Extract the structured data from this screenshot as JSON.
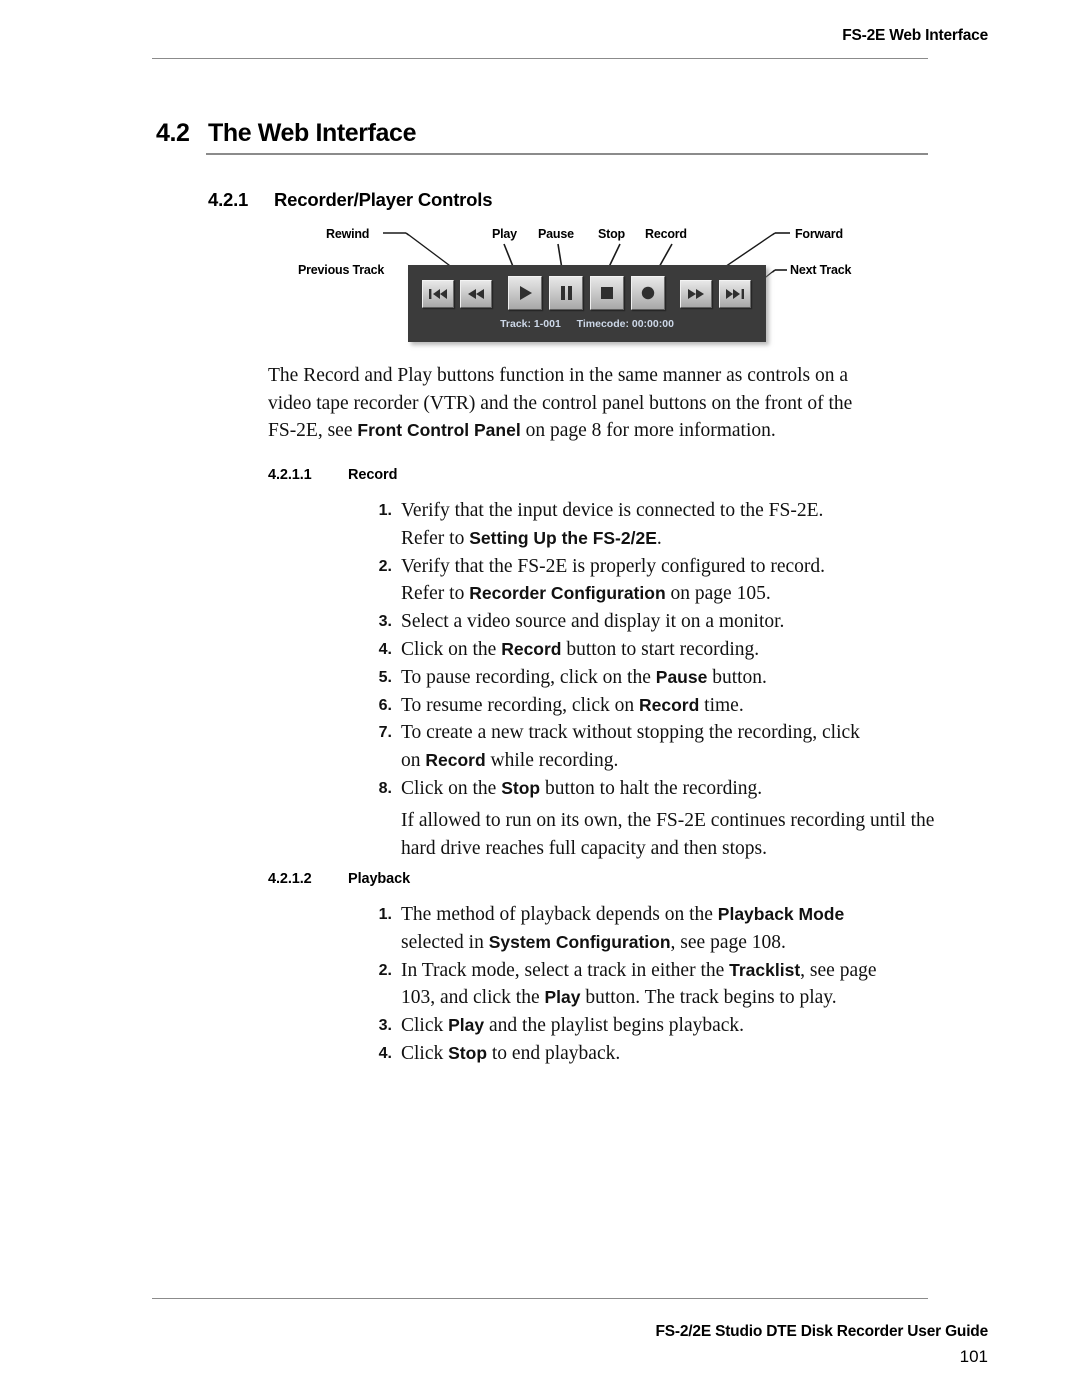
{
  "header": {
    "running_head": "FS-2E Web Interface"
  },
  "headings": {
    "h2_number": "4.2",
    "h2_title": "The Web Interface",
    "h3_number": "4.2.1",
    "h3_title": "Recorder/Player Controls",
    "h4_record_number": "4.2.1.1",
    "h4_record_title": "Record",
    "h4_playback_number": "4.2.1.2",
    "h4_playback_title": "Playback"
  },
  "figure": {
    "callouts": {
      "rewind": "Rewind",
      "previous_track": "Previous Track",
      "play": "Play",
      "pause": "Pause",
      "stop": "Stop",
      "record": "Record",
      "forward": "Forward",
      "next_track": "Next Track"
    },
    "panel": {
      "background_color": "#3b3b3b",
      "button_face_color": "#cccccc",
      "status_text_color": "#cdd8e8",
      "track_label": "Track: 1-001",
      "timecode_label": "Timecode: 00:00:00",
      "buttons": [
        {
          "name": "previous-track",
          "glyph": "skip-back"
        },
        {
          "name": "rewind",
          "glyph": "rewind"
        },
        {
          "name": "play",
          "glyph": "play"
        },
        {
          "name": "pause",
          "glyph": "pause"
        },
        {
          "name": "stop",
          "glyph": "stop"
        },
        {
          "name": "record",
          "glyph": "record"
        },
        {
          "name": "forward",
          "glyph": "fast-forward"
        },
        {
          "name": "next-track",
          "glyph": "skip-forward"
        }
      ]
    }
  },
  "body": {
    "intro_line1": "The Record and Play buttons function in the same manner as controls on a",
    "intro_line2": "video tape recorder (VTR) and the control panel buttons on the front of the",
    "intro_line3_a": "FS-2E, see ",
    "intro_line3_bold": "Front Control Panel",
    "intro_line3_b": " on page 8 for more information."
  },
  "record_steps": [
    {
      "number": "1.",
      "line1": "Verify that the input device is connected to the FS-2E.",
      "line2_a": "Refer to ",
      "line2_bold": "Setting Up the FS-2/2E",
      "line2_b": "."
    },
    {
      "number": "2.",
      "line1": "Verify that the FS-2E is properly configured to record.",
      "line2_a": "Refer to ",
      "line2_bold": "Recorder Configuration",
      "line2_b": " on page 105."
    },
    {
      "number": "3.",
      "line1": "Select a video source and display it on a monitor."
    },
    {
      "number": "4.",
      "line1_a": "Click on the ",
      "line1_bold": "Record",
      "line1_b": " button to start recording."
    },
    {
      "number": "5.",
      "line1_a": "To pause recording, click on the ",
      "line1_bold": "Pause",
      "line1_b": " button."
    },
    {
      "number": "6.",
      "line1_a": "To resume recording, click on ",
      "line1_bold": "Record",
      "line1_b": " time."
    },
    {
      "number": "7.",
      "line1": "To create a new track without stopping the recording, click",
      "line2_a": "on ",
      "line2_bold": "Record",
      "line2_b": " while recording."
    },
    {
      "number": "8.",
      "line1_a": "Click on the ",
      "line1_bold": "Stop",
      "line1_b": " button to halt the recording."
    }
  ],
  "record_note": {
    "line1": "If allowed to run on its own, the FS-2E continues recording",
    "line2": "until the hard drive reaches full capacity and then stops."
  },
  "playback_steps": [
    {
      "number": "1.",
      "line1_a": "The method of playback depends on the ",
      "line1_bold": "Playback Mode",
      "line2_a": "selected in ",
      "line2_bold": "System Configuration",
      "line2_b": ", see page 108."
    },
    {
      "number": "2.",
      "line1_a": "In Track mode, select a track in either the ",
      "line1_bold": "Tracklist",
      "line1_b": ", see page",
      "line2_a": "103, and click the ",
      "line2_bold": "Play",
      "line2_b": " button. The track begins to play."
    },
    {
      "number": "3.",
      "line1_a": "Click ",
      "line1_bold": "Play",
      "line1_b": " and the playlist begins playback."
    },
    {
      "number": "4.",
      "line1_a": "Click ",
      "line1_bold": "Stop",
      "line1_b": " to end playback."
    }
  ],
  "footer": {
    "title": "FS-2/2E Studio DTE Disk Recorder User Guide",
    "page_number": "101"
  }
}
